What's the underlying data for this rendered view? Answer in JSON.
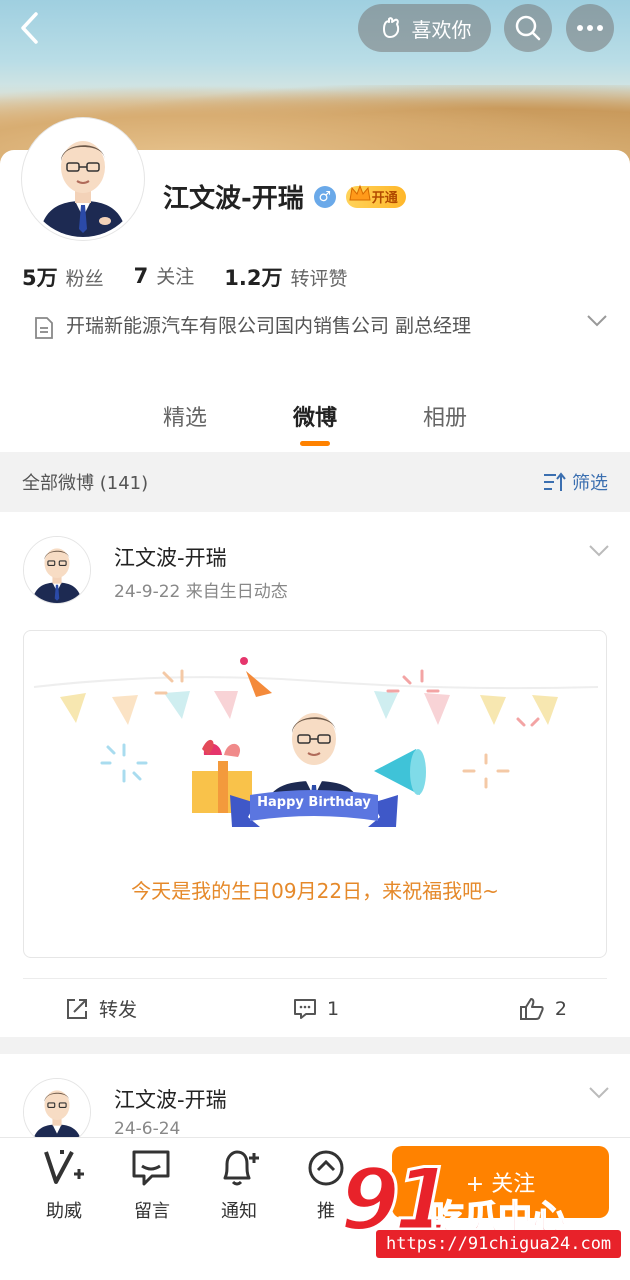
{
  "header": {
    "like_label": "喜欢你"
  },
  "profile": {
    "name": "江文波-开瑞",
    "gender_symbol": "♂",
    "vip_label": "开通",
    "stats": [
      {
        "value": "5万",
        "label": "粉丝"
      },
      {
        "value": "7",
        "label": "关注"
      },
      {
        "value": "1.2万",
        "label": "转评赞"
      }
    ],
    "description": "开瑞新能源汽车有限公司国内销售公司 副总经理",
    "tabs": [
      "精选",
      "微博",
      "相册"
    ],
    "active_tab": "微博"
  },
  "filter": {
    "left": "全部微博 (141)",
    "right": "筛选"
  },
  "posts": [
    {
      "author": "江文波-开瑞",
      "meta": "24-9-22  来自生日动态",
      "banner_text": "Happy Birthday",
      "card_text": "今天是我的生日09月22日，来祝福我吧~",
      "share_label": "转发",
      "comment_count": "1",
      "like_count": "2"
    },
    {
      "author": "江文波-开瑞",
      "meta": "24-6-24"
    }
  ],
  "bottom_bar": {
    "items": [
      "助威",
      "留言",
      "通知",
      "推"
    ],
    "follow_label": "+ 关注"
  },
  "watermark": {
    "big": "91",
    "cn": "吃瓜中心",
    "url": "https://91chigua24.com"
  },
  "colors": {
    "accent": "#ff8200",
    "link": "#3b6fb0",
    "birthday_text": "#e5892a",
    "watermark": "#e8222a"
  }
}
